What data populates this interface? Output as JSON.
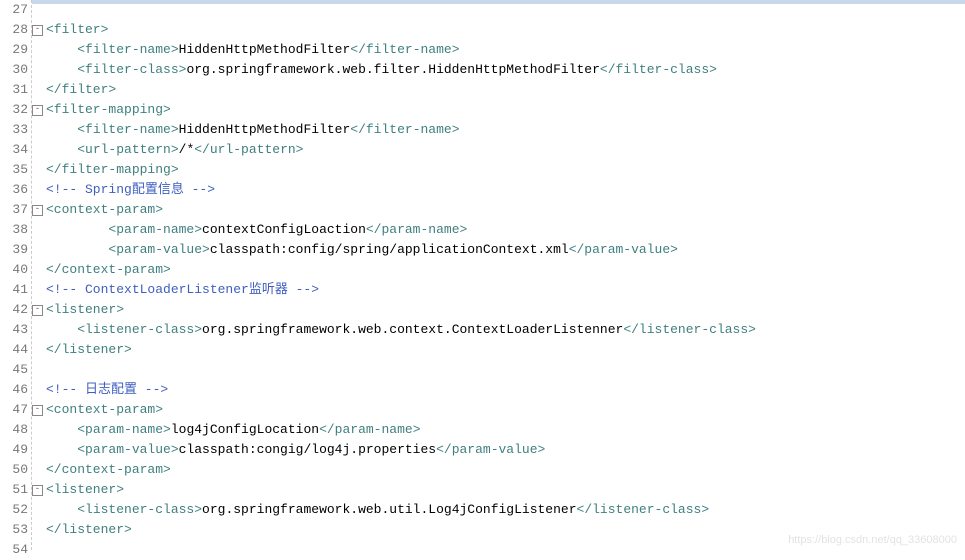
{
  "watermark": "https://blog.csdn.net/qq_33608000",
  "lines": [
    {
      "num": "27",
      "fold": "",
      "segs": []
    },
    {
      "num": "28",
      "fold": "⊟",
      "segs": [
        {
          "c": "tag",
          "t": "<filter>"
        }
      ]
    },
    {
      "num": "29",
      "fold": "",
      "segs": [
        {
          "c": "txt",
          "t": "    "
        },
        {
          "c": "tag",
          "t": "<filter-name>"
        },
        {
          "c": "txt",
          "t": "HiddenHttpMethodFilter"
        },
        {
          "c": "tag",
          "t": "</filter-name>"
        }
      ]
    },
    {
      "num": "30",
      "fold": "",
      "segs": [
        {
          "c": "txt",
          "t": "    "
        },
        {
          "c": "tag",
          "t": "<filter-class>"
        },
        {
          "c": "txt",
          "t": "org.springframework.web.filter.HiddenHttpMethodFilter"
        },
        {
          "c": "tag",
          "t": "</filter-class>"
        }
      ]
    },
    {
      "num": "31",
      "fold": "",
      "segs": [
        {
          "c": "tag",
          "t": "</filter>"
        }
      ]
    },
    {
      "num": "32",
      "fold": "⊟",
      "segs": [
        {
          "c": "tag",
          "t": "<filter-mapping>"
        }
      ]
    },
    {
      "num": "33",
      "fold": "",
      "segs": [
        {
          "c": "txt",
          "t": "    "
        },
        {
          "c": "tag",
          "t": "<filter-name>"
        },
        {
          "c": "txt",
          "t": "HiddenHttpMethodFilter"
        },
        {
          "c": "tag",
          "t": "</filter-name>"
        }
      ]
    },
    {
      "num": "34",
      "fold": "",
      "segs": [
        {
          "c": "txt",
          "t": "    "
        },
        {
          "c": "tag",
          "t": "<url-pattern>"
        },
        {
          "c": "txt",
          "t": "/*"
        },
        {
          "c": "tag",
          "t": "</url-pattern>"
        }
      ]
    },
    {
      "num": "35",
      "fold": "",
      "segs": [
        {
          "c": "tag",
          "t": "</filter-mapping>"
        }
      ]
    },
    {
      "num": "36",
      "fold": "",
      "segs": [
        {
          "c": "comment",
          "t": "<!-- Spring配置信息 -->"
        }
      ]
    },
    {
      "num": "37",
      "fold": "⊟",
      "segs": [
        {
          "c": "tag",
          "t": "<context-param>"
        }
      ]
    },
    {
      "num": "38",
      "fold": "",
      "segs": [
        {
          "c": "txt",
          "t": "        "
        },
        {
          "c": "tag",
          "t": "<param-name>"
        },
        {
          "c": "txt",
          "t": "contextConfigLoaction"
        },
        {
          "c": "tag",
          "t": "</param-name>"
        }
      ]
    },
    {
      "num": "39",
      "fold": "",
      "segs": [
        {
          "c": "txt",
          "t": "        "
        },
        {
          "c": "tag",
          "t": "<param-value>"
        },
        {
          "c": "txt",
          "t": "classpath:config/spring/applicationContext.xml"
        },
        {
          "c": "tag",
          "t": "</param-value>"
        }
      ]
    },
    {
      "num": "40",
      "fold": "",
      "segs": [
        {
          "c": "tag",
          "t": "</context-param>"
        }
      ]
    },
    {
      "num": "41",
      "fold": "",
      "segs": [
        {
          "c": "comment",
          "t": "<!-- ContextLoaderListener监听器 -->"
        }
      ]
    },
    {
      "num": "42",
      "fold": "⊟",
      "segs": [
        {
          "c": "tag",
          "t": "<listener>"
        }
      ]
    },
    {
      "num": "43",
      "fold": "",
      "segs": [
        {
          "c": "txt",
          "t": "    "
        },
        {
          "c": "tag",
          "t": "<listener-class>"
        },
        {
          "c": "txt",
          "t": "org.springframework.web.context.ContextLoaderListenner"
        },
        {
          "c": "tag",
          "t": "</listener-class>"
        }
      ]
    },
    {
      "num": "44",
      "fold": "",
      "segs": [
        {
          "c": "tag",
          "t": "</listener>"
        }
      ]
    },
    {
      "num": "45",
      "fold": "",
      "segs": []
    },
    {
      "num": "46",
      "fold": "",
      "segs": [
        {
          "c": "comment",
          "t": "<!-- 日志配置 -->"
        }
      ]
    },
    {
      "num": "47",
      "fold": "⊟",
      "segs": [
        {
          "c": "tag",
          "t": "<context-param>"
        }
      ]
    },
    {
      "num": "48",
      "fold": "",
      "segs": [
        {
          "c": "txt",
          "t": "    "
        },
        {
          "c": "tag",
          "t": "<param-name>"
        },
        {
          "c": "txt",
          "t": "log4jConfigLocation"
        },
        {
          "c": "tag",
          "t": "</param-name>"
        }
      ]
    },
    {
      "num": "49",
      "fold": "",
      "segs": [
        {
          "c": "txt",
          "t": "    "
        },
        {
          "c": "tag",
          "t": "<param-value>"
        },
        {
          "c": "txt",
          "t": "classpath:congig/log4j.properties"
        },
        {
          "c": "tag",
          "t": "</param-value>"
        }
      ]
    },
    {
      "num": "50",
      "fold": "",
      "segs": [
        {
          "c": "tag",
          "t": "</context-param>"
        }
      ]
    },
    {
      "num": "51",
      "fold": "⊟",
      "segs": [
        {
          "c": "tag",
          "t": "<listener>"
        }
      ]
    },
    {
      "num": "52",
      "fold": "",
      "segs": [
        {
          "c": "txt",
          "t": "    "
        },
        {
          "c": "tag",
          "t": "<listener-class>"
        },
        {
          "c": "txt",
          "t": "org.springframework.web.util.Log4jConfigListener"
        },
        {
          "c": "tag",
          "t": "</listener-class>"
        }
      ]
    },
    {
      "num": "53",
      "fold": "",
      "segs": [
        {
          "c": "tag",
          "t": "</listener>"
        }
      ]
    },
    {
      "num": "54",
      "fold": "",
      "segs": []
    }
  ]
}
